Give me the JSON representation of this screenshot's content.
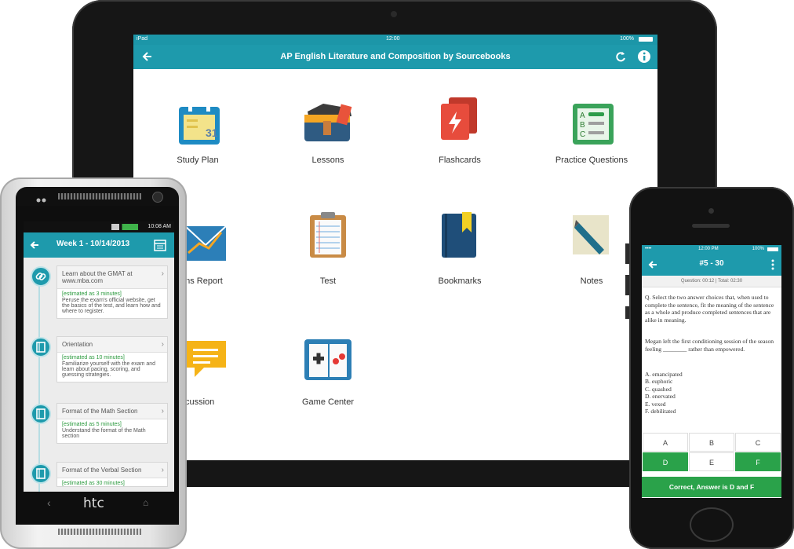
{
  "ipad": {
    "status": {
      "carrier": "iPad",
      "time": "12:00",
      "battery": "100%"
    },
    "title": "AP English Literature and Composition by Sourcebooks",
    "tiles": [
      {
        "label": "Study Plan",
        "icon": "calendar-icon"
      },
      {
        "label": "Lessons",
        "icon": "satchel-icon"
      },
      {
        "label": "Flashcards",
        "icon": "flashcards-icon"
      },
      {
        "label": "Practice Questions",
        "icon": "checklist-icon"
      },
      {
        "label": "ons Report",
        "icon": "chart-envelope-icon"
      },
      {
        "label": "Test",
        "icon": "clipboard-icon"
      },
      {
        "label": "Bookmarks",
        "icon": "bookmark-book-icon"
      },
      {
        "label": "Notes",
        "icon": "pencil-icon"
      },
      {
        "label": "cussion",
        "icon": "chat-bubble-icon"
      },
      {
        "label": "Game Center",
        "icon": "gamepad-book-icon"
      }
    ]
  },
  "htc": {
    "status_time": "10:08 AM",
    "nav_title": "Week 1 - 10/14/2013",
    "brand": "htc",
    "steps": [
      {
        "title": "Learn about the GMAT at www.mba.com",
        "estimate": "[estimated as 3 minutes]",
        "desc": "Peruse the exam's official website, get the basics of the test, and learn how and where to register."
      },
      {
        "title": "Orientation",
        "estimate": "[estimated as 10 minutes]",
        "desc": "Familiarize yourself with the exam and learn about pacing, scoring, and guessing strategies."
      },
      {
        "title": "Format of the Math Section",
        "estimate": "[estimated as 5 minutes]",
        "desc": "Understand the format of the Math section"
      },
      {
        "title": "Format of the Verbal Section",
        "estimate": "[estimated as 30 minutes]",
        "desc": ""
      }
    ]
  },
  "iphone": {
    "status": {
      "carrier": "•••• ",
      "time": "12:00 PM",
      "battery": "100%"
    },
    "nav_title": "#5 - 30",
    "timer": "Question: 00:12 | Total: 02:30",
    "question": "Q. Select the two answer choices that, when used to complete the sentence, fit the meaning of the sentence as a whole and produce completed sentences that are alike in meaning.",
    "prompt": "Megan left the first conditioning session of the season feeling ________ rather than empowered.",
    "choices": [
      "A. emancipated",
      "B. euphoric",
      "C. quashed",
      "D. enervated",
      "E. vexed",
      "F. debilitated"
    ],
    "answers": [
      "A",
      "B",
      "C",
      "D",
      "E",
      "F"
    ],
    "selected": [
      "D",
      "F"
    ],
    "result": "Correct, Answer is D and F"
  },
  "colors": {
    "teal": "#1e9aac",
    "green": "#2aa24a"
  }
}
